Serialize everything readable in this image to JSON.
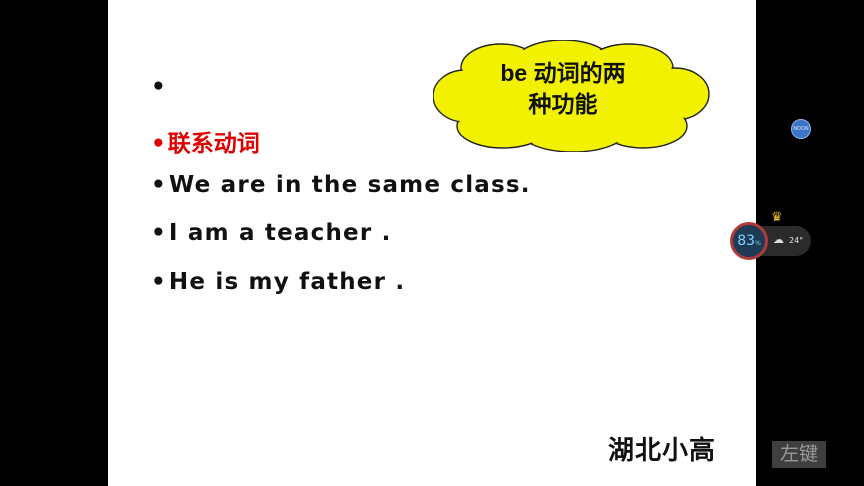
{
  "slide": {
    "lines": [
      {
        "bullet": "•",
        "text": ""
      },
      {
        "bullet": "•",
        "text": "联系动词"
      },
      {
        "bullet": "•",
        "text": "We are in the same class."
      },
      {
        "bullet": "•",
        "text": "I am a teacher ."
      },
      {
        "bullet": "•",
        "text": "He is my father ."
      }
    ],
    "cloud": {
      "line1": "be 动词的两",
      "line2": "种功能",
      "fill_color": "#f2f200"
    },
    "signature": "湖北小高",
    "highlight_color": "#e00000"
  },
  "overlay": {
    "small_circle_label": "NOON",
    "battery": {
      "value": "83",
      "unit": "%"
    },
    "weather": {
      "temperature": "24°",
      "icon": "rain-cloud-icon"
    },
    "crown_icon": "crown-icon",
    "left_click_label": "左键"
  }
}
